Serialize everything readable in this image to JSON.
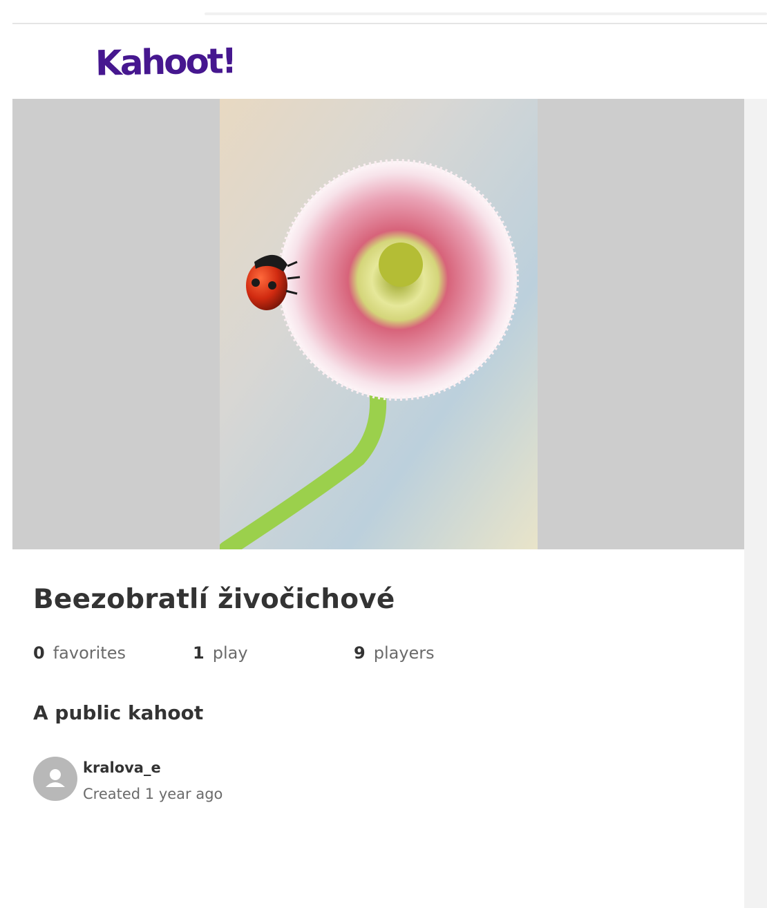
{
  "brand": {
    "logo_text": "Kahoot!",
    "color": "#46178f"
  },
  "kahoot": {
    "title": "Beezobratlí živočichové",
    "stats": {
      "favorites": {
        "count": "0",
        "label": "favorites"
      },
      "plays": {
        "count": "1",
        "label": "play"
      },
      "players": {
        "count": "9",
        "label": "players"
      }
    },
    "visibility": "A public kahoot",
    "cover_image": {
      "icon": "ladybug-on-daisy-photo"
    },
    "creator": {
      "username": "kralova_e",
      "created": "Created 1 year ago",
      "avatar_icon": "user-avatar-icon"
    }
  },
  "colors": {
    "hero_background": "#cdcdcd",
    "text_primary": "#333333",
    "text_secondary": "#6a6a6a"
  }
}
